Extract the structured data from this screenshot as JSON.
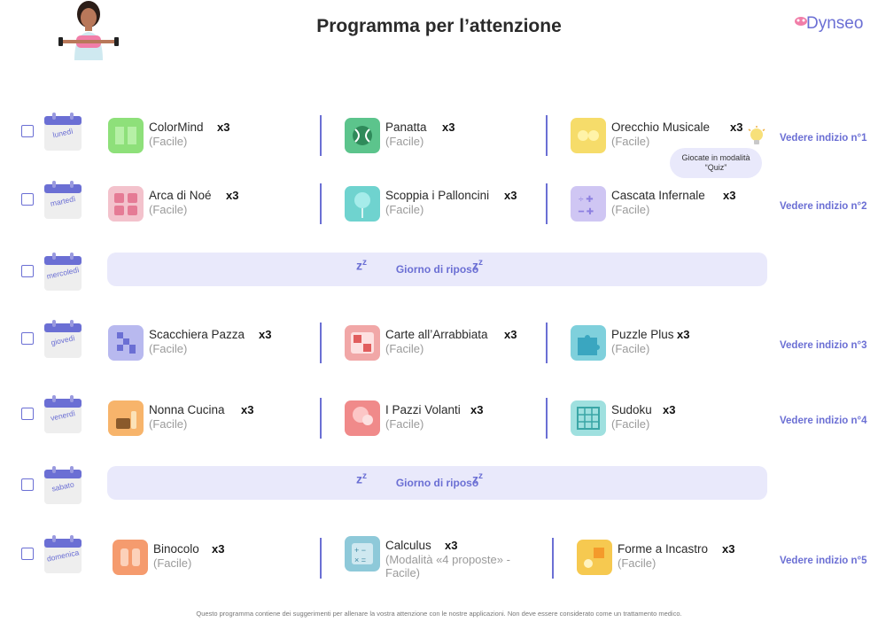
{
  "title": "Programma per l’attenzione",
  "brand": {
    "name": "Dynseo",
    "accent": "#6b6fd4"
  },
  "footer": "Questo programma contiene dei suggerimenti per allenare la vostra attenzione con le nostre applicazioni. Non deve essere considerato come un trattamento medico.",
  "tip_bubble": "Giocate in modalità “Quiz”",
  "rest_label": "Giorno di riposo",
  "days": [
    {
      "day": "lunedì",
      "hint": "Vedere indizio n°1",
      "activities": [
        {
          "name": "ColorMind",
          "count": "x3",
          "level": "(Facile)",
          "icon": "colormind-icon",
          "color": "#8ee07a"
        },
        {
          "name": "Panatta",
          "count": "x3",
          "level": "(Facile)",
          "icon": "tennis-ball-icon",
          "color": "#5cc48c"
        },
        {
          "name": "Orecchio Musicale",
          "count": "x3",
          "level": "(Facile)",
          "icon": "music-icon",
          "color": "#f6dc6a"
        }
      ]
    },
    {
      "day": "martedì",
      "hint": "Vedere indizio n°2",
      "activities": [
        {
          "name": "Arca di Noé",
          "count": "x3",
          "level": "(Facile)",
          "icon": "animal-cards-icon",
          "color": "#f3c2cc"
        },
        {
          "name": "Scoppia i Palloncini",
          "count": "x3",
          "level": "(Facile)",
          "icon": "balloon-icon",
          "color": "#6fd3cf"
        },
        {
          "name": "Cascata Infernale",
          "count": "x3",
          "level": "(Facile)",
          "icon": "math-symbols-icon",
          "color": "#cfc6f3"
        }
      ]
    },
    {
      "day": "mercoledì",
      "rest": true
    },
    {
      "day": "giovedì",
      "hint": "Vedere indizio n°3",
      "activities": [
        {
          "name": "Scacchiera Pazza",
          "count": "x3",
          "level": "(Facile)",
          "icon": "chessboard-icon",
          "color": "#b8b9ef"
        },
        {
          "name": "Carte all’Arrabbiata",
          "count": "x3",
          "level": "(Facile)",
          "icon": "cards-icon",
          "color": "#f1a7a7"
        },
        {
          "name": "Puzzle Plus",
          "count": "x3",
          "level": "(Facile)",
          "icon": "puzzle-icon",
          "color": "#7fd0dc"
        }
      ]
    },
    {
      "day": "venerdì",
      "hint": "Vedere indizio n°4",
      "activities": [
        {
          "name": "Nonna Cucina",
          "count": "x3",
          "level": "(Facile)",
          "icon": "cooking-icon",
          "color": "#f7b46b"
        },
        {
          "name": "I Pazzi Volanti",
          "count": "x3",
          "level": "(Facile)",
          "icon": "flying-balloon-icon",
          "color": "#f08a8a"
        },
        {
          "name": "Sudoku",
          "count": "x3",
          "level": "(Facile)",
          "icon": "sudoku-grid-icon",
          "color": "#9fe0df"
        }
      ]
    },
    {
      "day": "sabato",
      "rest": true
    },
    {
      "day": "domenica",
      "hint": "Vedere indizio n°5",
      "activities": [
        {
          "name": "Binocolo",
          "count": "x3",
          "level": "(Facile)",
          "icon": "binoculars-icon",
          "color": "#f59b6e"
        },
        {
          "name": "Calculus",
          "count": "x3",
          "level": "(Modalità «4 proposte» - Facile)",
          "icon": "calculator-icon",
          "color": "#8ec9d9"
        },
        {
          "name": "Forme a Incastro",
          "count": "x3",
          "level": "(Facile)",
          "icon": "shapes-icon",
          "color": "#f6c950"
        }
      ]
    }
  ]
}
